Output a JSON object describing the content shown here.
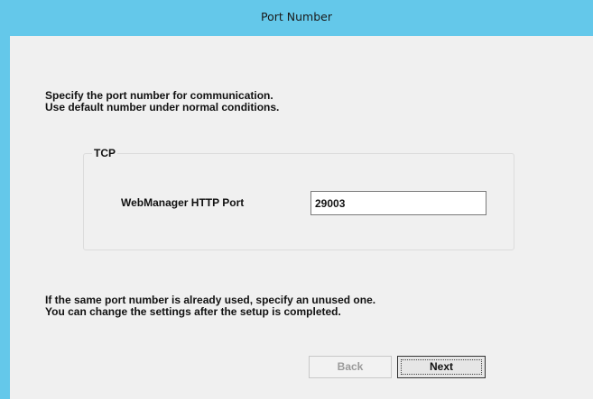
{
  "window": {
    "title": "Port Number",
    "title_bar_color": "#64c8ea",
    "client_color": "#f0f0f0"
  },
  "intro": {
    "line1": "Specify the port number for communication.",
    "line2": "Use default number under normal conditions."
  },
  "tcp_group": {
    "legend": "TCP",
    "webmanager_label": "WebManager HTTP Port",
    "webmanager_port_value": "29003"
  },
  "notice": {
    "line1": "If the same port number is already used, specify an unused one.",
    "line2": "You can change the settings after the setup is completed."
  },
  "buttons": {
    "back_label": "Back",
    "back_enabled": false,
    "next_label": "Next"
  }
}
